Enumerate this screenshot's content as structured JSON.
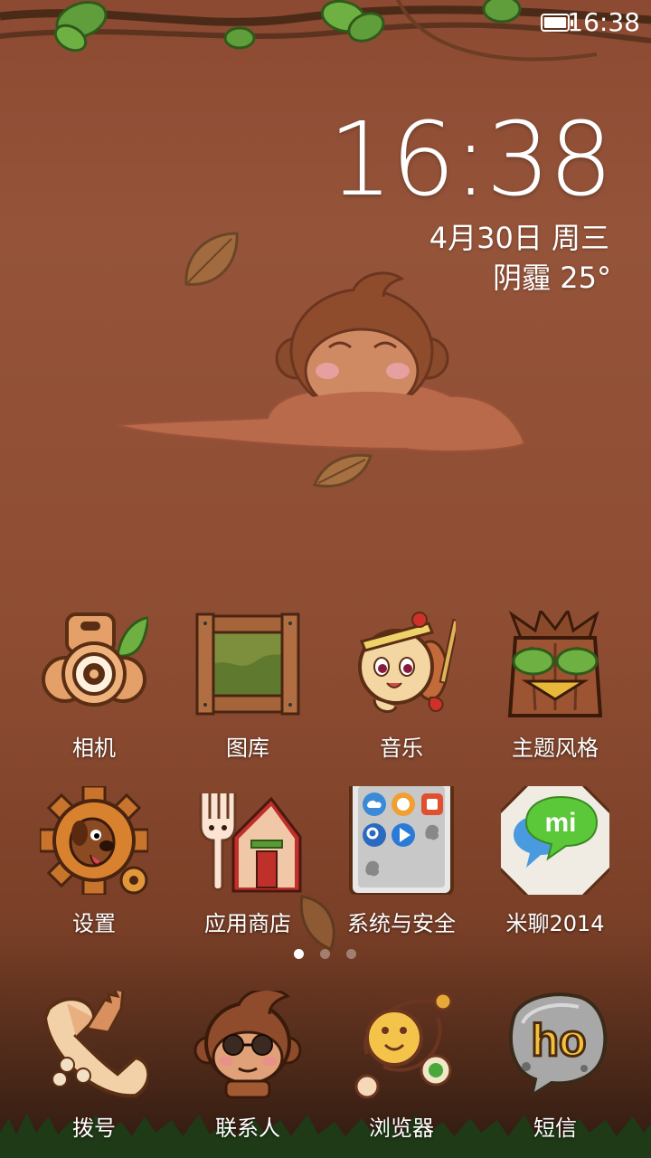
{
  "status_bar": {
    "time": "16:38",
    "battery_icon": "battery-full-icon"
  },
  "clock_widget": {
    "time": "16:38",
    "date": "4月30日 周三",
    "weather": "阴霾  25°"
  },
  "apps": [
    {
      "label": "相机",
      "icon": "camera-icon"
    },
    {
      "label": "图库",
      "icon": "gallery-frame-icon"
    },
    {
      "label": "音乐",
      "icon": "music-drum-girl-icon"
    },
    {
      "label": "主题风格",
      "icon": "theme-tree-stump-icon"
    },
    {
      "label": "设置",
      "icon": "settings-gear-dog-icon"
    },
    {
      "label": "应用商店",
      "icon": "app-store-house-icon"
    },
    {
      "label": "系统与安全",
      "icon": "system-folder-icon"
    },
    {
      "label": "米聊2014",
      "icon": "miliao-chat-icon"
    }
  ],
  "page_indicator": {
    "pages": 3,
    "active": 1
  },
  "dock": [
    {
      "label": "拨号",
      "icon": "phone-dialer-icon"
    },
    {
      "label": "联系人",
      "icon": "contacts-monkey-icon"
    },
    {
      "label": "浏览器",
      "icon": "browser-planet-icon"
    },
    {
      "label": "短信",
      "icon": "sms-rock-icon"
    }
  ],
  "colors": {
    "background": "#8e4d33",
    "text": "#ffffff",
    "leaf": "#5f9e3a"
  }
}
